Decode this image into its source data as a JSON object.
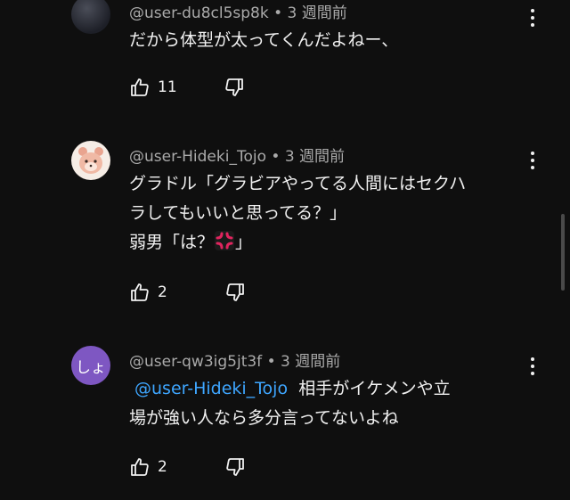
{
  "comments": [
    {
      "author": "@user-du8cl5sp8k",
      "time": "3 週間前",
      "lines": [
        "だから体型が太ってくんだよねー、"
      ],
      "likes": "11",
      "avatar_text": ""
    },
    {
      "author": "@user-Hideki_Tojo",
      "time": "3 週間前",
      "lines": [
        "グラドル「グラビアやってる人間にはセクハ",
        "ラしてもいいと思ってる？」",
        "弱男「は？",
        "」"
      ],
      "likes": "2",
      "avatar_text": ""
    },
    {
      "author": "@user-qw3ig5jt3f",
      "time": "3 週間前",
      "mention": "@user-Hideki_Tojo",
      "lines": [
        "相手がイケメンや立",
        "場が強い人なら多分言ってないよね"
      ],
      "likes": "2",
      "avatar_text": "しょ"
    }
  ],
  "separator": " • ",
  "icons": {
    "like": "thumbs-up-icon",
    "dislike": "thumbs-down-icon",
    "menu": "more-vert-icon",
    "emoji": "anger-symbol-icon"
  },
  "colors": {
    "background": "#0f0f0f",
    "text": "#f1f1f1",
    "meta": "#aaaaaa",
    "mention": "#3ea6ff",
    "avatar_letter_bg": "#7e57c2",
    "anger_emoji": "#e0245e"
  }
}
